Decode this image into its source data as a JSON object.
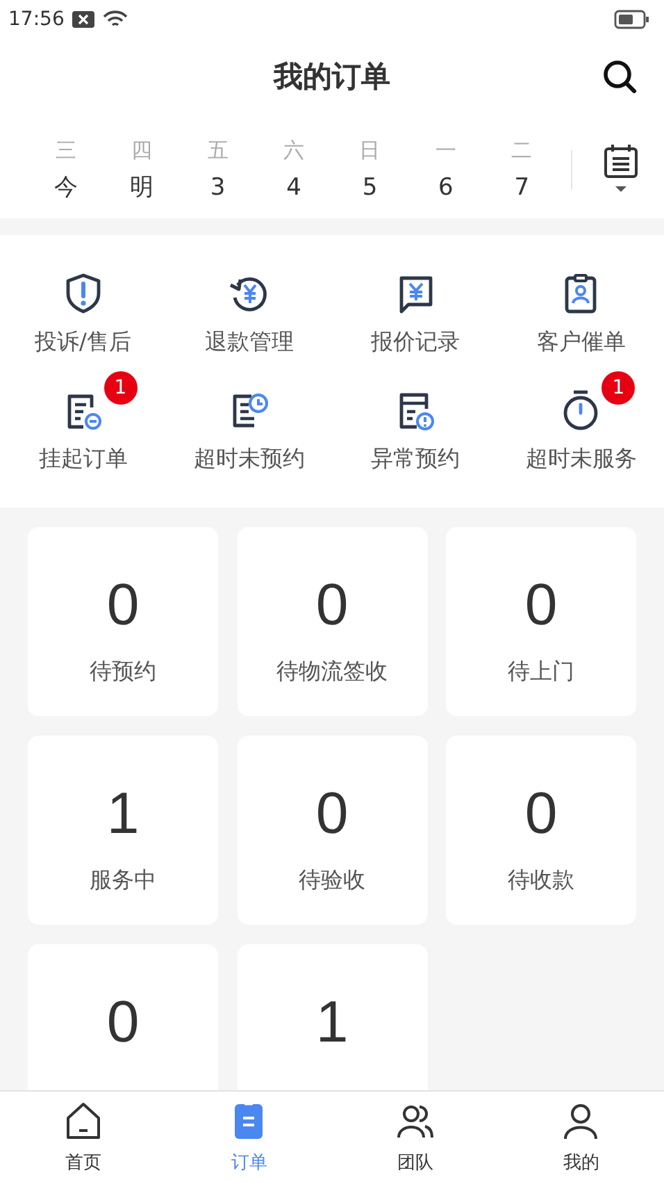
{
  "status_bar": {
    "time": "17:56"
  },
  "header": {
    "title": "我的订单"
  },
  "date_strip": [
    {
      "weekday": "三",
      "date": "今"
    },
    {
      "weekday": "四",
      "date": "明"
    },
    {
      "weekday": "五",
      "date": "3"
    },
    {
      "weekday": "六",
      "date": "4"
    },
    {
      "weekday": "日",
      "date": "5"
    },
    {
      "weekday": "一",
      "date": "6"
    },
    {
      "weekday": "二",
      "date": "7"
    }
  ],
  "shortcuts": [
    {
      "kind": "shield",
      "label": "投诉/售后"
    },
    {
      "kind": "refund",
      "label": "退款管理"
    },
    {
      "kind": "quote",
      "label": "报价记录"
    },
    {
      "kind": "clipboard",
      "label": "客户催单"
    },
    {
      "kind": "suspend",
      "label": "挂起订单",
      "badge": "1"
    },
    {
      "kind": "overdue",
      "label": "超时未预约"
    },
    {
      "kind": "abnormal",
      "label": "异常预约"
    },
    {
      "kind": "stopwatch",
      "label": "超时未服务",
      "badge": "1"
    }
  ],
  "order_counts": [
    {
      "count": "0",
      "label": "待预约"
    },
    {
      "count": "0",
      "label": "待物流签收"
    },
    {
      "count": "0",
      "label": "待上门"
    },
    {
      "count": "1",
      "label": "服务中"
    },
    {
      "count": "0",
      "label": "待验收"
    },
    {
      "count": "0",
      "label": "待收款"
    },
    {
      "count": "0"
    },
    {
      "count": "1"
    }
  ],
  "tab_bar": [
    {
      "kind": "home",
      "label": "首页",
      "selected": false
    },
    {
      "kind": "orders",
      "label": "订单",
      "selected": true
    },
    {
      "kind": "team",
      "label": "团队",
      "selected": false
    },
    {
      "kind": "me",
      "label": "我的",
      "selected": false
    }
  ]
}
